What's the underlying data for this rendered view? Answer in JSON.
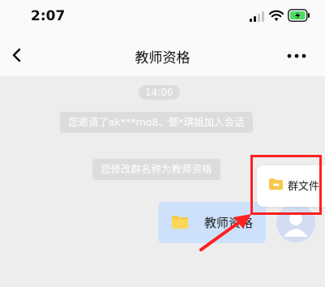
{
  "status_bar": {
    "time": "2:07",
    "battery_color": "#4cd964"
  },
  "nav": {
    "title": "教师资格",
    "back_icon": "chevron-left-icon",
    "more_icon": "more-dots-icon"
  },
  "chat": {
    "timestamp": "14:06",
    "system_messages": [
      "您邀请了ak***mo8、鄧*琪姐加入会话",
      "您修改群名称为教师资格"
    ],
    "file_message": {
      "name": "教师资格",
      "icon": "folder-icon"
    }
  },
  "group_files": {
    "label": "群文件",
    "icon": "folder-icon"
  },
  "annotation": {
    "highlight_color": "#ff2020"
  }
}
